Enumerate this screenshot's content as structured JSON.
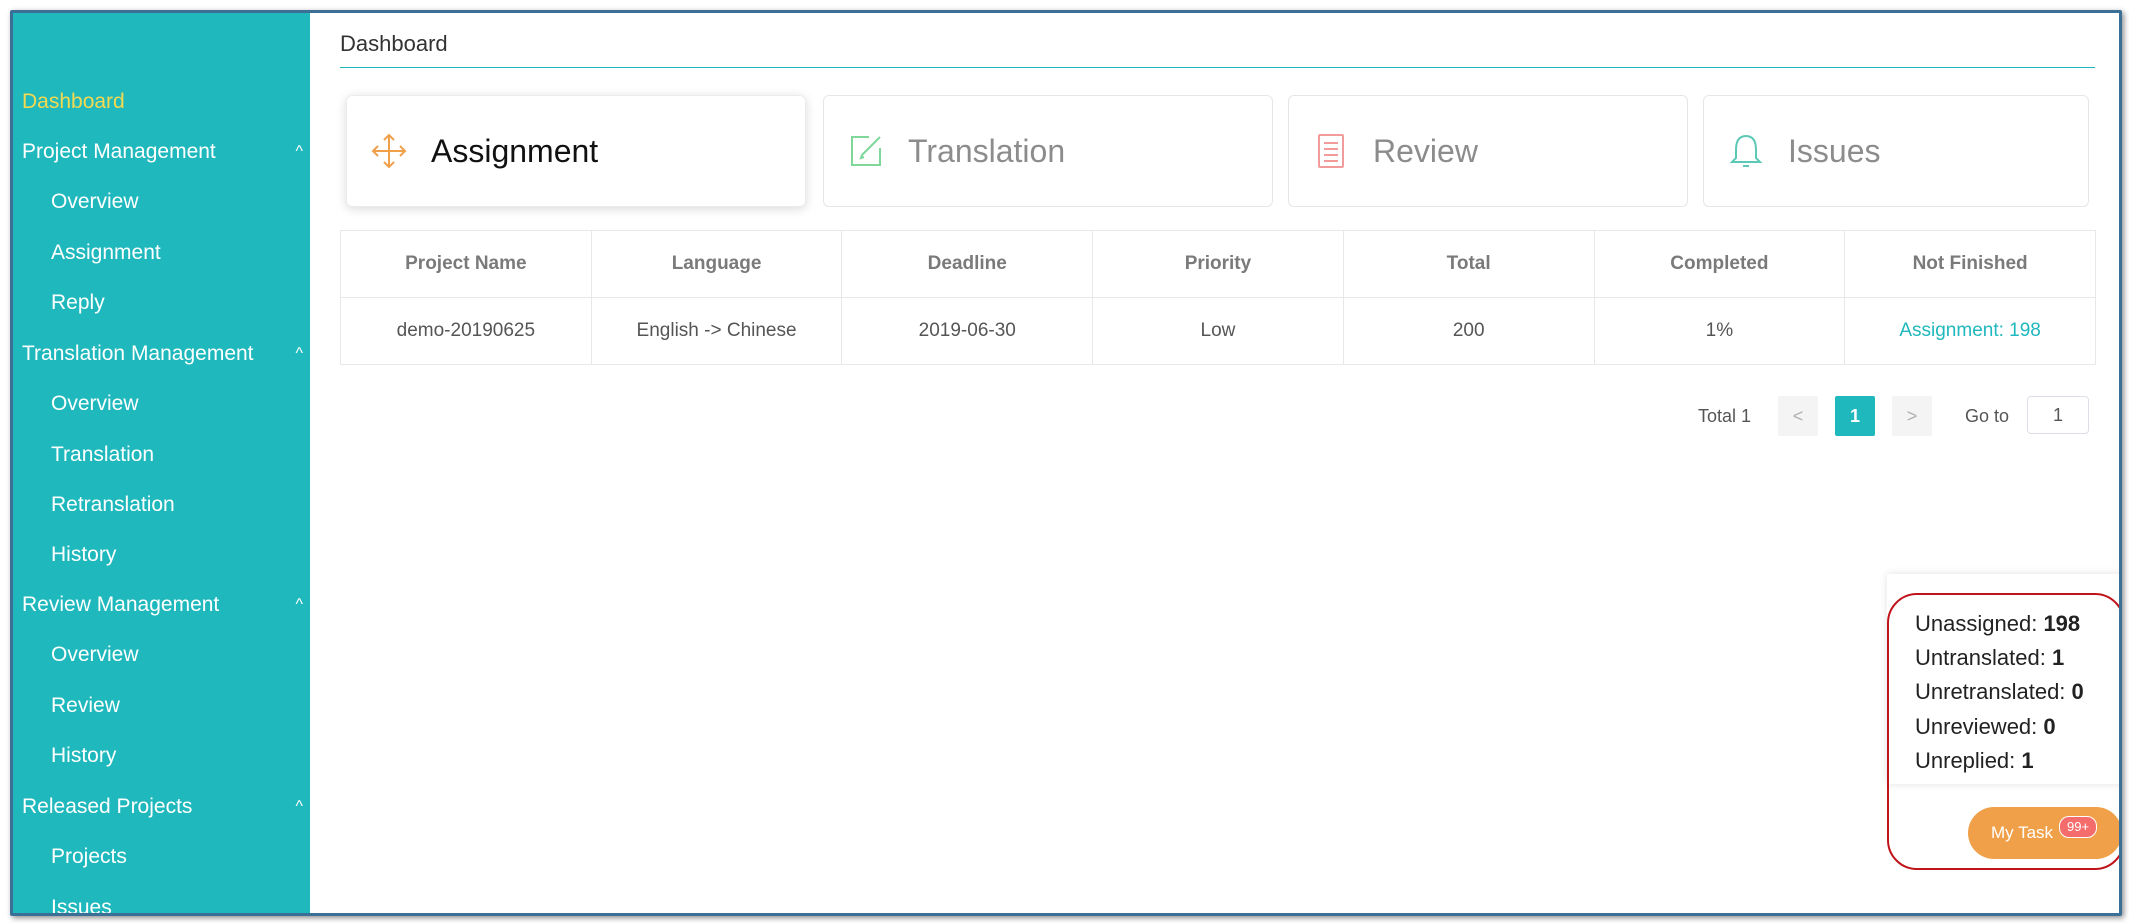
{
  "sidebar": {
    "items": [
      {
        "label": "Dashboard",
        "level": "top",
        "active": true
      },
      {
        "label": "Project Management",
        "level": "top",
        "expanded": true
      },
      {
        "label": "Overview",
        "level": "sub"
      },
      {
        "label": "Assignment",
        "level": "sub"
      },
      {
        "label": "Reply",
        "level": "sub"
      },
      {
        "label": "Translation Management",
        "level": "top",
        "expanded": true
      },
      {
        "label": "Overview",
        "level": "sub"
      },
      {
        "label": "Translation",
        "level": "sub"
      },
      {
        "label": "Retranslation",
        "level": "sub"
      },
      {
        "label": "History",
        "level": "sub"
      },
      {
        "label": "Review Management",
        "level": "top",
        "expanded": true
      },
      {
        "label": "Overview",
        "level": "sub"
      },
      {
        "label": "Review",
        "level": "sub"
      },
      {
        "label": "History",
        "level": "sub"
      },
      {
        "label": "Released Projects",
        "level": "top",
        "expanded": true
      },
      {
        "label": "Projects",
        "level": "sub"
      },
      {
        "label": "Issues",
        "level": "sub"
      }
    ],
    "chevron_glyph": "^"
  },
  "breadcrumb": "Dashboard",
  "tabs": [
    {
      "label": "Assignment",
      "icon": "move-arrows-icon",
      "color": "#f0a048",
      "active": true
    },
    {
      "label": "Translation",
      "icon": "edit-icon",
      "color": "#7fd79a",
      "active": false
    },
    {
      "label": "Review",
      "icon": "document-icon",
      "color": "#f29b9b",
      "active": false
    },
    {
      "label": "Issues",
      "icon": "bell-icon",
      "color": "#5cc9b6",
      "active": false
    }
  ],
  "table": {
    "columns": [
      "Project Name",
      "Language",
      "Deadline",
      "Priority",
      "Total",
      "Completed",
      "Not Finished"
    ],
    "rows": [
      [
        "demo-20190625",
        "English -> Chinese",
        "2019-06-30",
        "Low",
        "200",
        "1%",
        "Assignment: 198"
      ]
    ]
  },
  "pagination": {
    "total_label": "Total 1",
    "prev": "<",
    "current": "1",
    "next": ">",
    "goto_label": "Go to",
    "goto_value": "1"
  },
  "task_summary": {
    "items": [
      {
        "label": "Unassigned:",
        "value": "198"
      },
      {
        "label": "Untranslated:",
        "value": "1"
      },
      {
        "label": "Unretranslated:",
        "value": "0"
      },
      {
        "label": "Unreviewed:",
        "value": "0"
      },
      {
        "label": "Unreplied:",
        "value": "1"
      }
    ],
    "button_label": "My Task",
    "badge": "99+"
  },
  "colors": {
    "sidebar": "#1fb8bd",
    "accent": "#1fb8bd",
    "active_nav": "#f5d94e",
    "task_button": "#f0a048",
    "badge": "#f56c6c",
    "highlight": "#c0141b"
  }
}
